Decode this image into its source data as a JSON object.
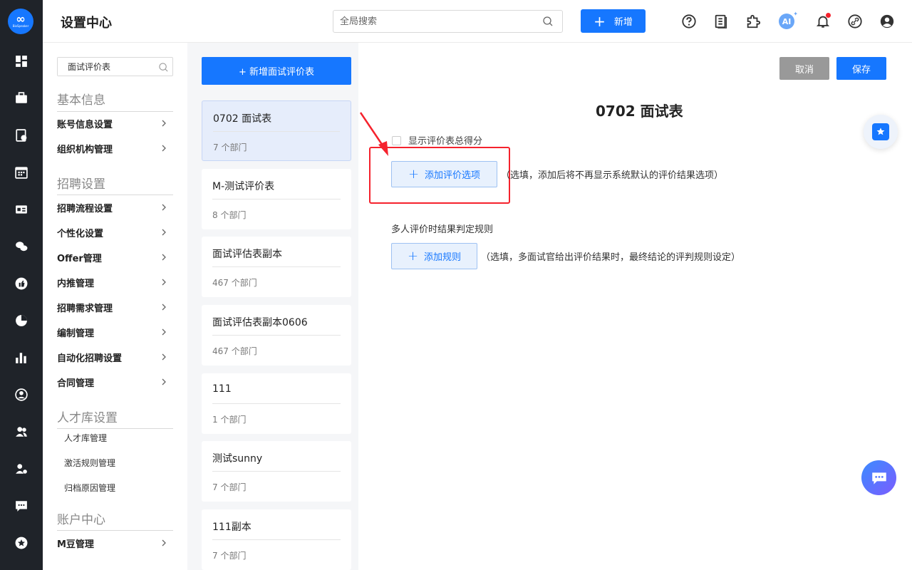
{
  "app": {
    "brand": "BioSpeaker",
    "page_title": "设置中心"
  },
  "topbar": {
    "search_placeholder": "全局搜索",
    "new_label": "新增",
    "icons": [
      "help-icon",
      "document-icon",
      "plugin-icon",
      "ai-icon",
      "bell-icon",
      "link-icon",
      "user-icon"
    ],
    "ai_label": "AI"
  },
  "nav": {
    "search_value": "面试评价表",
    "sections": [
      {
        "title": "基本信息",
        "items": [
          "账号信息设置",
          "组织机构管理"
        ]
      },
      {
        "title": "招聘设置",
        "items": [
          "招聘流程设置",
          "个性化设置",
          "Offer管理",
          "内推管理",
          "招聘需求管理",
          "编制管理",
          "自动化招聘设置",
          "合同管理"
        ]
      },
      {
        "title": "人才库设置",
        "subitems": [
          "人才库管理",
          "激活规则管理",
          "归档原因管理"
        ]
      },
      {
        "title": "账户中心",
        "items": [
          "M豆管理"
        ]
      }
    ]
  },
  "eval_list": {
    "add_label": "+ 新增面试评价表",
    "items": [
      {
        "name": "0702 面试表",
        "meta": "7 个部门"
      },
      {
        "name": "M-测试评价表",
        "meta": "8 个部门"
      },
      {
        "name": "面试评估表副本",
        "meta": "467 个部门"
      },
      {
        "name": "面试评估表副本0606",
        "meta": "467 个部门"
      },
      {
        "name": "111",
        "meta": "1 个部门"
      },
      {
        "name": "测试sunny",
        "meta": "7 个部门"
      },
      {
        "name": "111副本",
        "meta": "7 个部门"
      }
    ]
  },
  "main": {
    "cancel_label": "取消",
    "save_label": "保存",
    "form_title": "0702 面试表",
    "show_total_label": "显示评价表总得分",
    "add_option_label": "添加评价选项",
    "add_option_hint": "（选填，添加后将不再显示系统默认的评价结果选项）",
    "rule_title": "多人评价时结果判定规则",
    "add_rule_label": "添加规则",
    "add_rule_hint": "（选填，多面试官给出评价结果时，最终结论的评判规则设定）"
  },
  "colors": {
    "primary": "#1677ff",
    "rail": "#1f2329",
    "highlight": "#f5222d"
  }
}
